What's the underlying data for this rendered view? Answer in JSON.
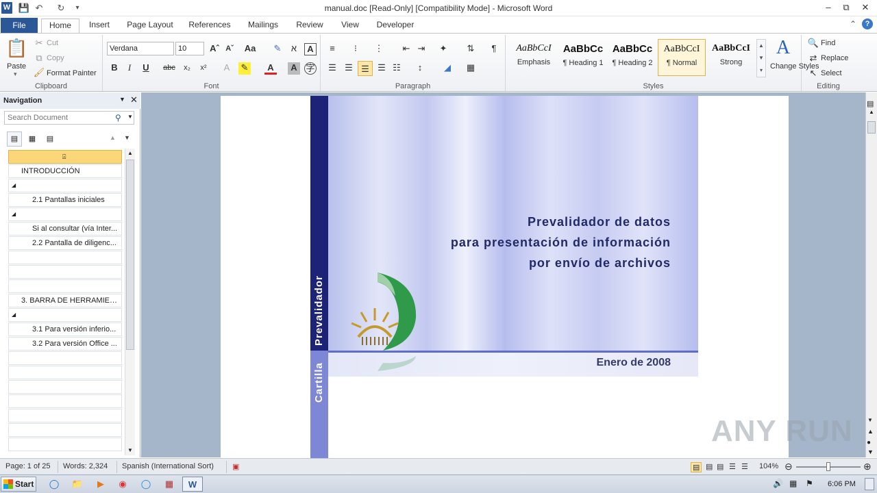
{
  "window": {
    "title": "manual.doc [Read-Only] [Compatibility Mode] - Microsoft Word",
    "app_icon": "W"
  },
  "tabs": [
    "File",
    "Home",
    "Insert",
    "Page Layout",
    "References",
    "Mailings",
    "Review",
    "View",
    "Developer"
  ],
  "active_tab": "Home",
  "clipboard": {
    "paste": "Paste",
    "cut": "Cut",
    "copy": "Copy",
    "format_painter": "Format Painter",
    "label": "Clipboard"
  },
  "font": {
    "family": "Verdana",
    "size": "10",
    "label": "Font"
  },
  "paragraph": {
    "label": "Paragraph"
  },
  "styles": {
    "label": "Styles",
    "items": [
      {
        "sample": "AaBbCcI",
        "name": "Emphasis"
      },
      {
        "sample": "AaBbCc",
        "name": "¶ Heading 1"
      },
      {
        "sample": "AaBbCc",
        "name": "¶ Heading 2"
      },
      {
        "sample": "AaBbCcI",
        "name": "¶ Normal"
      },
      {
        "sample": "AaBbCcI",
        "name": "Strong"
      }
    ],
    "selected": "¶ Normal",
    "change_styles": "Change Styles"
  },
  "editing": {
    "find": "Find",
    "replace": "Replace",
    "select": "Select",
    "label": "Editing"
  },
  "navigation": {
    "title": "Navigation",
    "search_placeholder": "Search Document",
    "items": [
      "",
      "INTRODUCCIÓN",
      "",
      "2.1 Pantallas iniciales",
      "",
      "Si al consultar (vía Inter...",
      "2.2 Pantalla de diligenc...",
      "",
      "",
      "",
      "3. BARRA DE HERRAMIENT...",
      "",
      "3.1 Para versión inferio...",
      "3.2 Para versión Office ...",
      "",
      "",
      "",
      "",
      "",
      "",
      ""
    ]
  },
  "document": {
    "spine_top": "Prevalidador",
    "spine_bottom": "Cartilla",
    "title_lines": [
      "Prevalidador de datos",
      "para presentación de información",
      "por envío de archivos"
    ],
    "date": "Enero de 2008"
  },
  "status": {
    "page": "Page: 1 of 25",
    "words": "Words: 2,324",
    "language": "Spanish (International Sort)",
    "zoom": "104%"
  },
  "taskbar": {
    "start": "Start",
    "time": "6:06 PM"
  },
  "watermark": "ANY RUN"
}
